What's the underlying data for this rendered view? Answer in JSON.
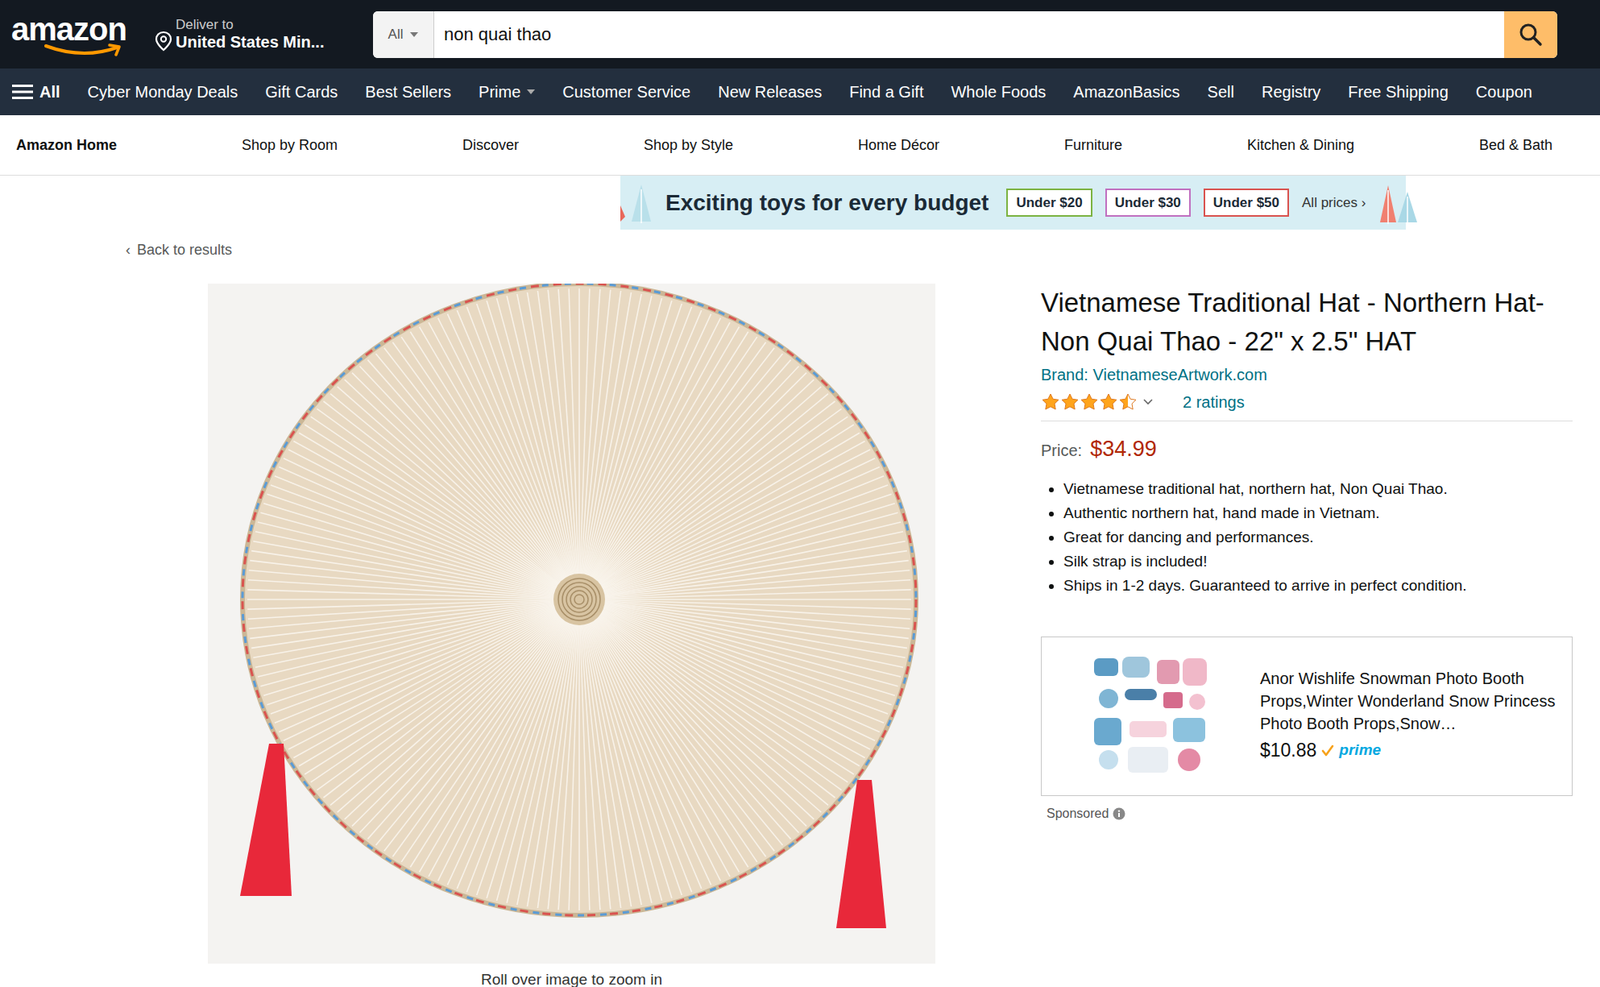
{
  "header": {
    "logo": "amazon",
    "deliver_label": "Deliver to",
    "deliver_location": "United States Min...",
    "search_category": "All",
    "search_value": "non quai thao"
  },
  "nav": {
    "menu_label": "All",
    "items": [
      {
        "label": "Cyber Monday Deals",
        "has_menu": false
      },
      {
        "label": "Gift Cards",
        "has_menu": false
      },
      {
        "label": "Best Sellers",
        "has_menu": false
      },
      {
        "label": "Prime",
        "has_menu": true
      },
      {
        "label": "Customer Service",
        "has_menu": false
      },
      {
        "label": "New Releases",
        "has_menu": false
      },
      {
        "label": "Find a Gift",
        "has_menu": false
      },
      {
        "label": "Whole Foods",
        "has_menu": false
      },
      {
        "label": "AmazonBasics",
        "has_menu": false
      },
      {
        "label": "Sell",
        "has_menu": false
      },
      {
        "label": "Registry",
        "has_menu": false
      },
      {
        "label": "Free Shipping",
        "has_menu": false
      },
      {
        "label": "Coupon",
        "has_menu": false
      }
    ]
  },
  "store_nav": {
    "items": [
      {
        "label": "Amazon Home",
        "selected": true
      },
      {
        "label": "Shop by Room",
        "selected": false
      },
      {
        "label": "Discover",
        "selected": false
      },
      {
        "label": "Shop by Style",
        "selected": false
      },
      {
        "label": "Home Décor",
        "selected": false
      },
      {
        "label": "Furniture",
        "selected": false
      },
      {
        "label": "Kitchen & Dining",
        "selected": false
      },
      {
        "label": "Bed & Bath",
        "selected": false
      }
    ]
  },
  "banner": {
    "title": "Exciting toys for every budget",
    "chips": [
      {
        "label": "Under $20",
        "color": "#7cb342"
      },
      {
        "label": "Under $30",
        "color": "#c070c0"
      },
      {
        "label": "Under $50",
        "color": "#d9534f"
      }
    ],
    "all_prices": "All prices ›"
  },
  "back": {
    "icon": "‹",
    "label": "Back to results"
  },
  "gallery": {
    "caption": "Roll over image to zoom in"
  },
  "product": {
    "title": "Vietnamese Traditional Hat - Northern Hat- Non Quai Thao - 22\" x 2.5\" HAT",
    "brand": "Brand: VietnameseArtwork.com",
    "stars": 4.5,
    "ratings": "2 ratings",
    "price_label": "Price:",
    "price": "$34.99",
    "bullets": [
      "Vietnamese traditional hat, northern hat, Non Quai Thao.",
      "Authentic northern hat, hand made in Vietnam.",
      "Great for dancing and performances.",
      "Silk strap is included!",
      "Ships in 1-2 days. Guaranteed to arrive in perfect condition."
    ]
  },
  "ad": {
    "title": "Anor Wishlife Snowman Photo Booth Props,Winter Wonderland Snow Princess Photo Booth Props,Snow…",
    "price": "$10.88",
    "prime": "prime",
    "sponsored": "Sponsored"
  }
}
